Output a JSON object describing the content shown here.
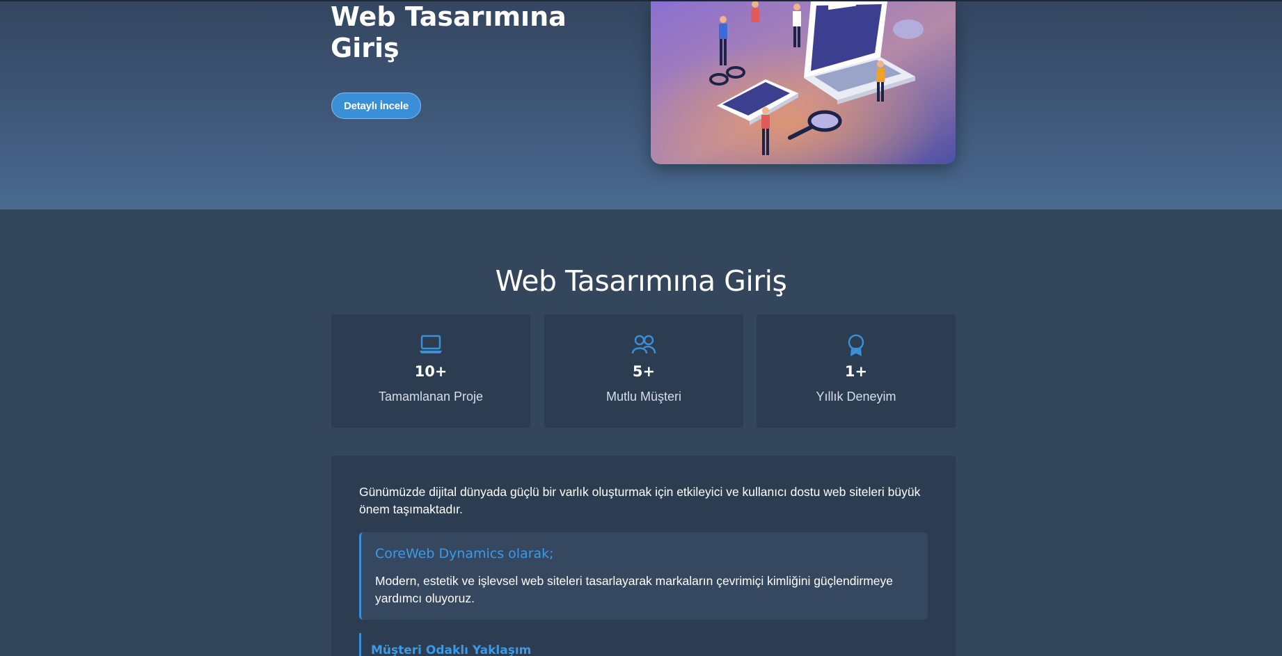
{
  "hero": {
    "title_line1": "Web Tasarımına",
    "title_line2": "Giriş",
    "button_label": "Detaylı İncele"
  },
  "section": {
    "title": "Web Tasarımına Giriş"
  },
  "stats": [
    {
      "icon": "laptop-icon",
      "value": "10+",
      "label": "Tamamlanan Proje"
    },
    {
      "icon": "users-icon",
      "value": "5+",
      "label": "Mutlu Müşteri"
    },
    {
      "icon": "award-icon",
      "value": "1+",
      "label": "Yıllık Deneyim"
    }
  ],
  "content": {
    "intro": "Günümüzde dijital dünyada güçlü bir varlık oluşturmak için etkileyici ve kullanıcı dostu web siteleri büyük önem taşımaktadır.",
    "callout_title": "CoreWeb Dynamics olarak;",
    "callout_text": "Modern, estetik ve işlevsel web siteleri tasarlayarak markaların çevrimiçi kimliğini güçlendirmeye yardımcı oluyoruz.",
    "sub_title": "Müşteri Odaklı Yaklaşım"
  },
  "colors": {
    "accent": "#3a8fd6",
    "background": "#34465c",
    "card": "#2c3d52"
  }
}
